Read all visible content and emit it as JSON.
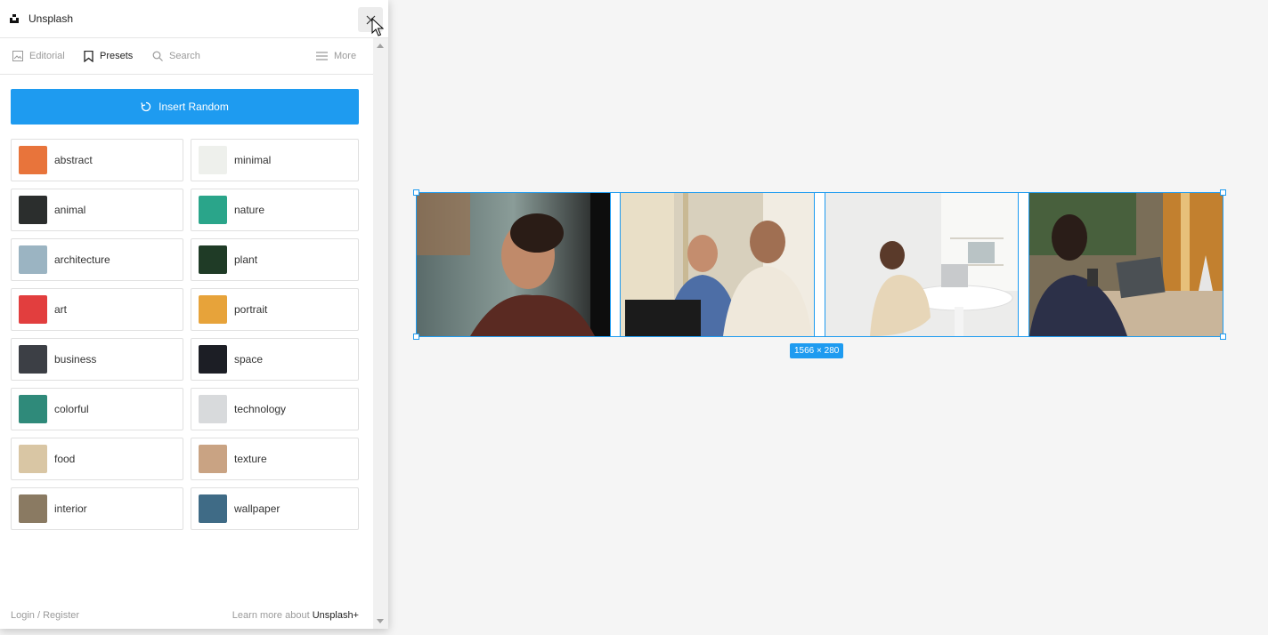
{
  "app": {
    "title": "Unsplash"
  },
  "tabs": [
    {
      "label": "Editorial",
      "icon": "image-icon",
      "active": false
    },
    {
      "label": "Presets",
      "icon": "bookmark-icon",
      "active": true
    },
    {
      "label": "Search",
      "icon": "search-icon",
      "active": false
    },
    {
      "label": "More",
      "icon": "menu-icon",
      "active": false
    }
  ],
  "insert_button": {
    "label": "Insert Random",
    "icon": "refresh-icon"
  },
  "presets": [
    {
      "label": "abstract",
      "thumb_color": "#e8743b"
    },
    {
      "label": "minimal",
      "thumb_color": "#eef0ec"
    },
    {
      "label": "animal",
      "thumb_color": "#2b2e2d"
    },
    {
      "label": "nature",
      "thumb_color": "#2aa58a"
    },
    {
      "label": "architecture",
      "thumb_color": "#9bb4c2"
    },
    {
      "label": "plant",
      "thumb_color": "#1f3b26"
    },
    {
      "label": "art",
      "thumb_color": "#e23e3e"
    },
    {
      "label": "portrait",
      "thumb_color": "#e7a33a"
    },
    {
      "label": "business",
      "thumb_color": "#3c3f45"
    },
    {
      "label": "space",
      "thumb_color": "#1c1e25"
    },
    {
      "label": "colorful",
      "thumb_color": "#2f8a7a"
    },
    {
      "label": "technology",
      "thumb_color": "#d8dadc"
    },
    {
      "label": "food",
      "thumb_color": "#d9c6a4"
    },
    {
      "label": "texture",
      "thumb_color": "#c9a383"
    },
    {
      "label": "interior",
      "thumb_color": "#8a7a62"
    },
    {
      "label": "wallpaper",
      "thumb_color": "#3f6b86"
    }
  ],
  "footer": {
    "login": "Login / Register",
    "learn_more": "Learn more about",
    "brand": "Unsplash+"
  },
  "canvas": {
    "size_label": "1566 × 280",
    "selection_color": "#1e9bf0"
  },
  "colors": {
    "accent": "#1e9bf0",
    "panel_bg": "#ffffff",
    "canvas_bg": "#f5f5f5"
  }
}
